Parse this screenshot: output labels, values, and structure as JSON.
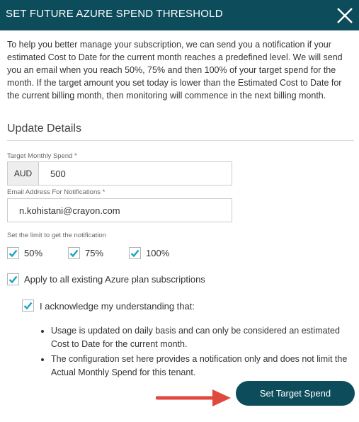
{
  "dialog": {
    "title": "SET FUTURE AZURE SPEND THRESHOLD",
    "close_icon": "close-icon"
  },
  "intro_text": "To help you better manage your subscription, we can send you a notification if your estimated Cost to Date for the current month reaches a predefined level. We will send you an email when you reach 50%, 75% and then 100% of your target spend for the month. If the target amount you set today is lower than the Estimated Cost to Date for the current billing month, then monitoring will commence in the next billing month.",
  "section_title": "Update Details",
  "target_spend": {
    "label": "Target Monthly Spend *",
    "currency": "AUD",
    "value": "500"
  },
  "email": {
    "label": "Email Address For Notifications *",
    "value": "n.kohistani@crayon.com"
  },
  "limits": {
    "label": "Set the limit to get the notification",
    "options": [
      {
        "label": "50%",
        "checked": true
      },
      {
        "label": "75%",
        "checked": true
      },
      {
        "label": "100%",
        "checked": true
      }
    ]
  },
  "apply_all": {
    "label": "Apply to all existing Azure plan subscriptions",
    "checked": true
  },
  "acknowledge": {
    "label": "I acknowledge my understanding that:",
    "checked": true
  },
  "bullets": [
    "Usage is updated on daily basis and can only be considered an estimated Cost to Date for the current month.",
    "The configuration set here provides a notification only and does not limit the Actual Monthly Spend for this tenant."
  ],
  "submit_label": "Set Target Spend",
  "colors": {
    "header": "#0d4d5b",
    "checkmark": "#1aa3c8",
    "arrow": "#e0493d"
  }
}
